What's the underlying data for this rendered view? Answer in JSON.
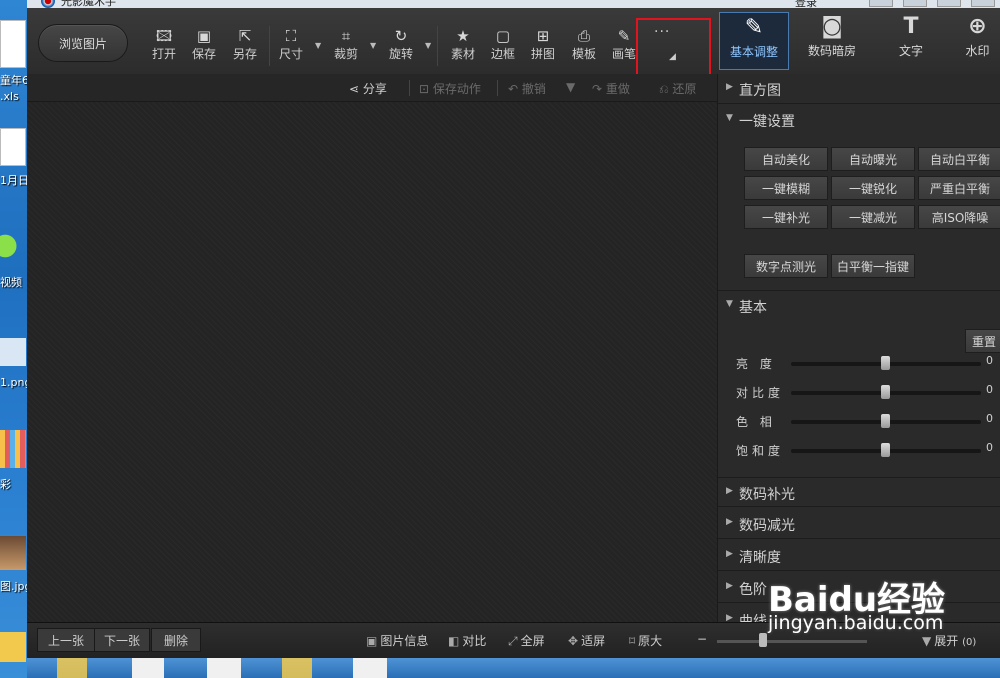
{
  "window": {
    "title": "光影魔术手",
    "login": "登录"
  },
  "desktop": {
    "labels": [
      "童年6",
      ".xls",
      "1月日",
      "视频",
      "1.png",
      "彩",
      "图.jpg"
    ]
  },
  "toolbar": {
    "browse": "浏览图片",
    "tools": [
      {
        "label": "打开",
        "icon": "open-icon",
        "glyph": "🖾"
      },
      {
        "label": "保存",
        "icon": "save-icon",
        "glyph": "▣"
      },
      {
        "label": "另存",
        "icon": "save-as-icon",
        "glyph": "⇱"
      },
      {
        "label": "尺寸",
        "icon": "resize-icon",
        "glyph": "⛶"
      },
      {
        "label": "裁剪",
        "icon": "crop-icon",
        "glyph": "⌗"
      },
      {
        "label": "旋转",
        "icon": "rotate-icon",
        "glyph": "↻"
      },
      {
        "label": "素材",
        "icon": "material-icon",
        "glyph": "★"
      },
      {
        "label": "边框",
        "icon": "frame-icon",
        "glyph": "▢"
      },
      {
        "label": "拼图",
        "icon": "puzzle-icon",
        "glyph": "⊞"
      },
      {
        "label": "模板",
        "icon": "template-icon",
        "glyph": "⎙"
      },
      {
        "label": "画笔",
        "icon": "brush-icon",
        "glyph": "✎"
      }
    ],
    "more": "···"
  },
  "subbar": {
    "share": "分享",
    "save_action": "保存动作",
    "undo": "撤销",
    "redo": "重做",
    "restore": "还原"
  },
  "right_tabs": [
    {
      "label": "基本调整",
      "icon": "adjust-icon",
      "glyph": "✎",
      "active": true
    },
    {
      "label": "数码暗房",
      "icon": "darkroom-icon",
      "glyph": "◙",
      "active": false
    },
    {
      "label": "文字",
      "icon": "text-icon",
      "glyph": "T",
      "active": false
    },
    {
      "label": "水印",
      "icon": "watermark-icon",
      "glyph": "⊕",
      "active": false
    }
  ],
  "panel": {
    "histogram": "直方图",
    "one_click": "一键设置",
    "one_click_buttons": [
      "自动美化",
      "自动曝光",
      "自动白平衡",
      "一键模糊",
      "一键锐化",
      "严重白平衡",
      "一键补光",
      "一键减光",
      "高ISO降噪"
    ],
    "extra_buttons": [
      "数字点测光",
      "白平衡一指键"
    ],
    "basic": "基本",
    "reset": "重置",
    "sliders": [
      {
        "label": "亮  度",
        "value": "0"
      },
      {
        "label": "对比度",
        "value": "0"
      },
      {
        "label": "色  相",
        "value": "0"
      },
      {
        "label": "饱和度",
        "value": "0"
      }
    ],
    "sections": [
      "数码补光",
      "数码减光",
      "清晰度",
      "色阶",
      "曲线"
    ]
  },
  "bottom": {
    "prev": "上一张",
    "next": "下一张",
    "delete": "删除",
    "info": "图片信息",
    "compare": "对比",
    "fullscreen": "全屏",
    "fit": "适屏",
    "original": "原大",
    "expand": "展开",
    "expand_count": "(0)"
  },
  "watermark": {
    "brand": "Baidu经验",
    "url": "jingyan.baidu.com"
  },
  "colors": {
    "highlight": "#e0141e",
    "accent": "#4a7bb0"
  }
}
